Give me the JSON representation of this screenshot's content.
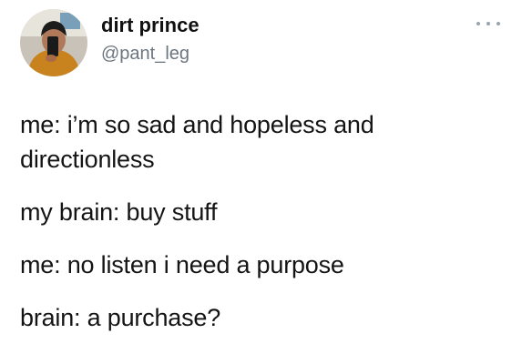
{
  "tweet": {
    "display_name": "dirt prince",
    "handle": "@pant_leg",
    "more_icon": "more-horizontal-icon",
    "lines": [
      "me: i’m so sad and hopeless and",
      "directionless",
      "my brain: buy stuff",
      "me: no listen i need a purpose",
      "brain: a purchase?"
    ]
  }
}
